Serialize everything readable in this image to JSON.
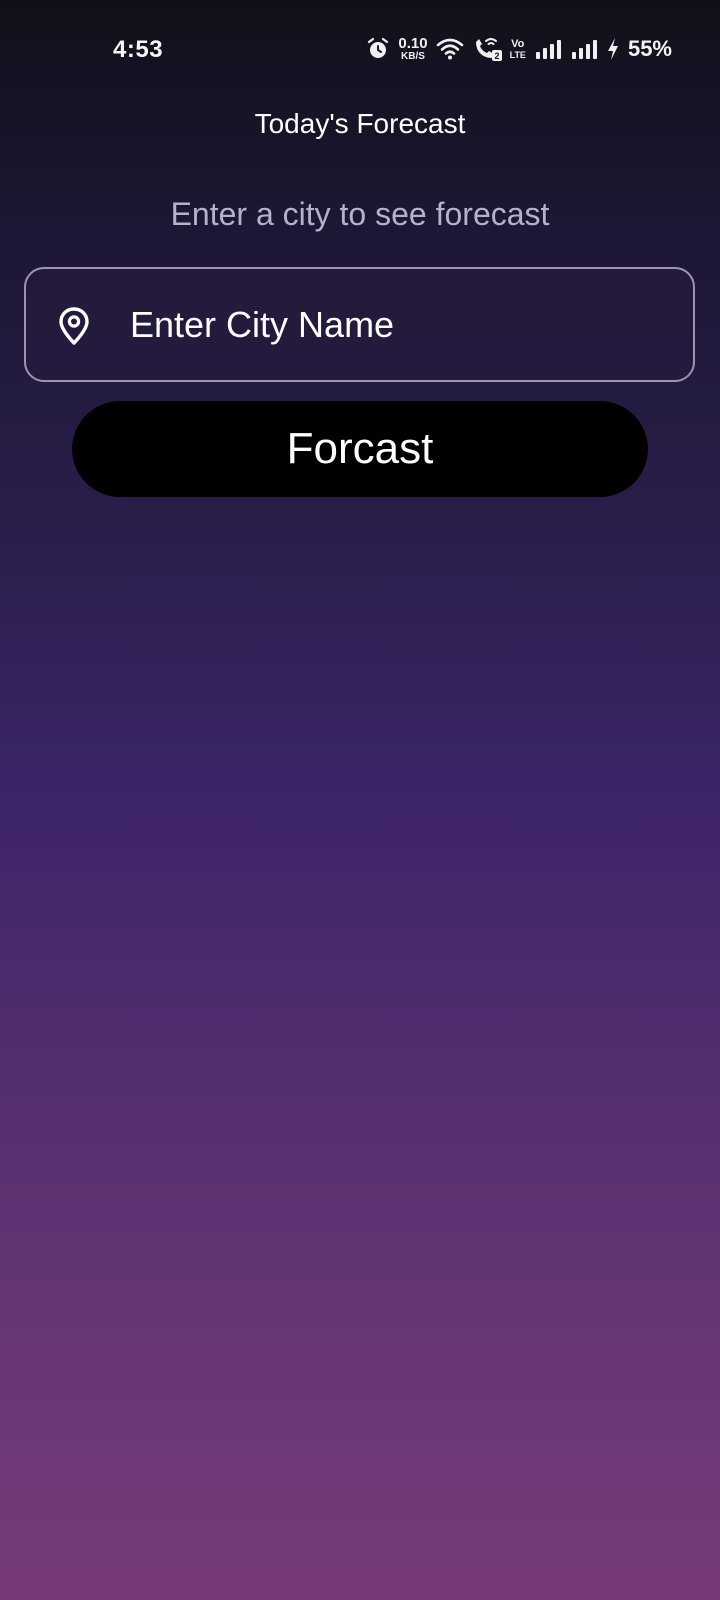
{
  "status_bar": {
    "time": "4:53",
    "net_speed_value": "0.10",
    "net_speed_unit": "KB/S",
    "volte_top": "Vo",
    "volte_bottom": "LTE",
    "battery_percent": "55%",
    "icons": [
      "alarm-icon",
      "wifi-icon",
      "wifi-calling-icon",
      "signal-icon",
      "signal-icon",
      "charging-bolt-icon"
    ]
  },
  "header": {
    "title": "Today's Forecast"
  },
  "main": {
    "subtitle": "Enter a city to see forecast",
    "city_input": {
      "placeholder": "Enter City Name",
      "value": "",
      "icon": "location-pin-icon"
    },
    "forecast_button_label": "Forcast"
  },
  "colors": {
    "gradient_top": "#111018",
    "gradient_mid": "#3d2568",
    "gradient_bottom": "#773a79",
    "button_bg": "#000000",
    "input_border": "#9d95ab",
    "subtitle_text": "#b7b0c8"
  }
}
